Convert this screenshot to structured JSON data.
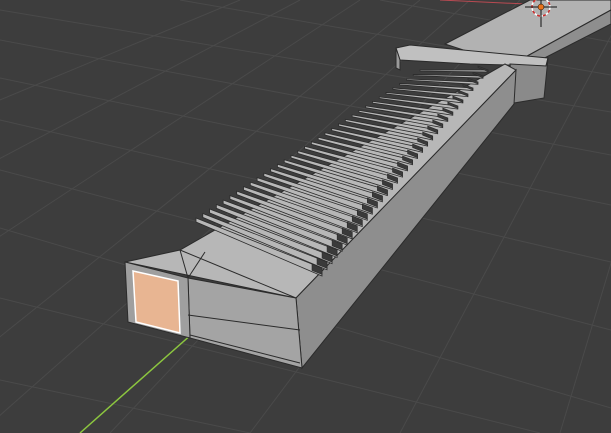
{
  "viewport": {
    "background_color": "#3d3d3d",
    "grid_color": "#4a4a4a",
    "show_floor_grid": true,
    "y_axis_color": "#8cc63f",
    "x_axis_color": "#b94a52"
  },
  "model": {
    "face_color": "#a9a9a9",
    "top_color": "#b7b7b7",
    "side_color": "#8e8e8e",
    "edge_color": "#2b2b2b",
    "selected_face_color": "#e8b592",
    "selected_face_outline": "#ffffff",
    "slat_count": 34
  },
  "origin_marker": {
    "icon": "3d-cursor-icon",
    "color": "#e8731d"
  }
}
